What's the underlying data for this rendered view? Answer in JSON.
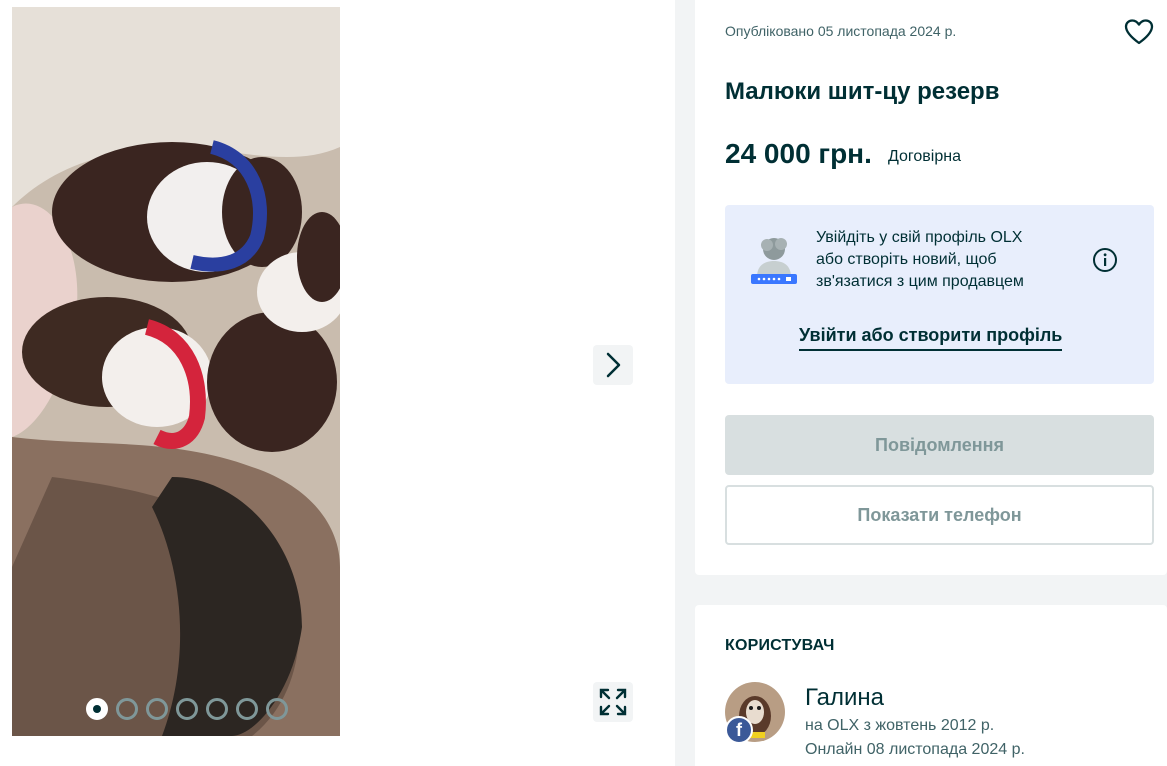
{
  "listing": {
    "published": "Опубліковано 05 листопада 2024 р.",
    "title": "Малюки шит-цу резерв",
    "price": "24 000 грн.",
    "negotiable": "Договірна"
  },
  "login_prompt": {
    "lines": [
      "Увійдіть у свій профіль OLX",
      "або створіть новий, щоб",
      "зв'язатися з цим продавцем"
    ],
    "link_label": "Увійти або створити профіль"
  },
  "actions": {
    "message_label": "Повідомлення",
    "phone_label": "Показати телефон"
  },
  "seller": {
    "heading": "КОРИСТУВАЧ",
    "name": "Галина",
    "since": "на OLX з жовтень 2012 р.",
    "last_online": "Онлайн 08 листопада 2024 р.",
    "badge": "f"
  },
  "gallery": {
    "image_count": 7,
    "active_index": 0
  },
  "icons": {
    "favorite": "heart-icon",
    "next": "chevron-right-icon",
    "fullscreen": "expand-icon",
    "info": "info-icon",
    "facebook": "facebook-icon"
  },
  "colors": {
    "primary_text": "#002f34",
    "muted_text": "#406367",
    "login_box_bg": "#e8eefc",
    "disabled_button": "#d8dfe0",
    "page_bg": "#f2f4f5"
  }
}
